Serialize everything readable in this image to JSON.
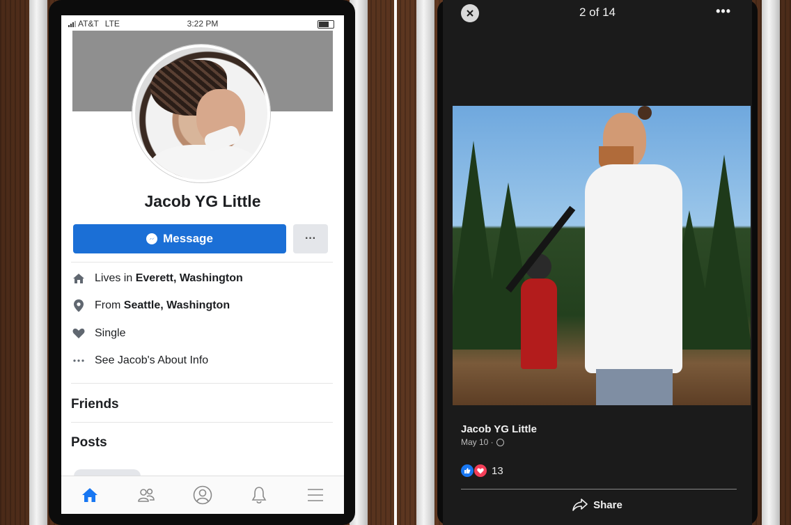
{
  "profile_screen": {
    "status": {
      "carrier": "AT&T",
      "network": "LTE",
      "time": "3:22 PM"
    },
    "name": "Jacob YG Little",
    "message_button": "Message",
    "more_button": "···",
    "info": [
      {
        "icon": "house-icon",
        "prefix": "Lives in ",
        "value": "Everett, Washington"
      },
      {
        "icon": "location-pin-icon",
        "prefix": "From ",
        "value": "Seattle, Washington"
      },
      {
        "icon": "heart-icon",
        "prefix": "",
        "value": "Single"
      },
      {
        "icon": "ellipsis-icon",
        "prefix": "",
        "value": "See Jacob's About Info"
      }
    ],
    "sections": {
      "friends": "Friends",
      "posts": "Posts"
    },
    "tabs": [
      "home-icon",
      "friends-icon",
      "profile-icon",
      "bell-icon",
      "menu-icon"
    ]
  },
  "photo_viewer": {
    "counter": "2 of 14",
    "more": "•••",
    "author": "Jacob YG Little",
    "date": "May 10 ·",
    "reaction_count": "13",
    "share_label": "Share"
  },
  "colors": {
    "facebook_blue": "#1b6fd6",
    "love_red": "#f33e58"
  }
}
